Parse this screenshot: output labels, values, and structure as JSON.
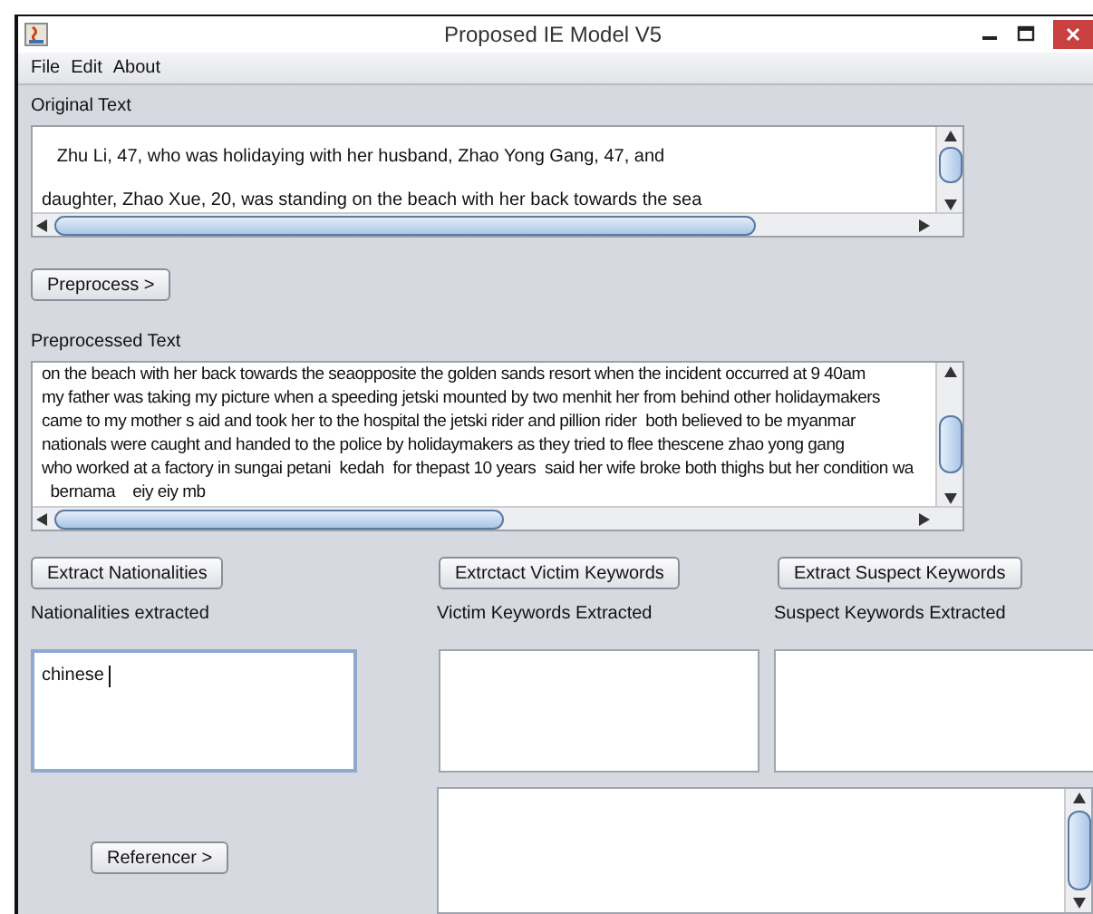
{
  "window": {
    "title": "Proposed IE Model V5"
  },
  "menu": [
    "File",
    "Edit",
    "About"
  ],
  "original_text": {
    "label": "Original Text",
    "lines": [
      "   Zhu Li, 47, who was holidaying with her husband, Zhao Yong Gang, 47, and",
      "daughter, Zhao Xue, 20, was standing on the beach with her back towards the sea"
    ]
  },
  "preprocess_button": "Preprocess >",
  "preprocessed_text": {
    "label": "Preprocessed Text",
    "lines": [
      "on the beach with her back towards the seaopposite the golden sands resort when the incident occurred at 9 40am",
      "my father was taking my picture when a speeding jetski mounted by two menhit her from behind other holidaymakers",
      "came to my mother s aid and took her to the hospital the jetski rider and pillion rider  both believed to be myanmar",
      "nationals were caught and handed to the police by holidaymakers as they tried to flee thescene zhao yong gang",
      "who worked at a factory in sungai petani  kedah  for thepast 10 years  said her wife broke both thighs but her condition wa",
      "  bernama    eiy eiy mb"
    ]
  },
  "action_buttons": [
    "Extract Nationalities",
    "Extrctact Victim Keywords",
    "Extract Suspect Keywords"
  ],
  "result_fields": [
    {
      "label": "Nationalities extracted",
      "value": "chinese ",
      "focused": true
    },
    {
      "label": "Victim Keywords Extracted",
      "focused": false
    },
    {
      "label": "Suspect Keywords Extracted",
      "focused": false
    }
  ],
  "referencer_button": "Referencer >"
}
